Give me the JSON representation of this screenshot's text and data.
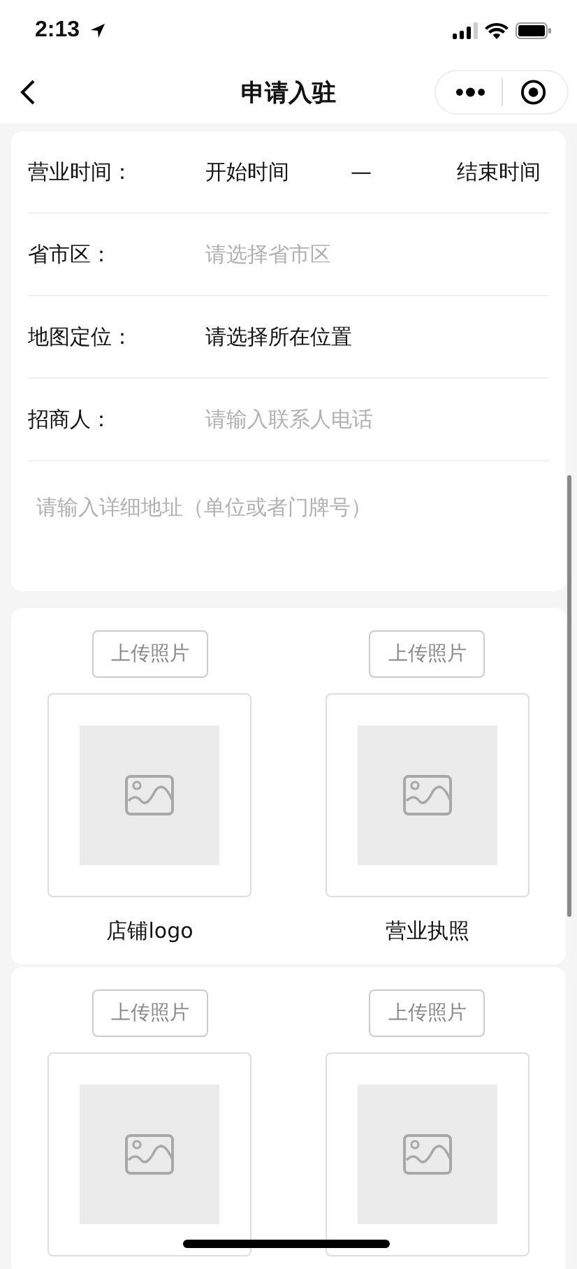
{
  "status_bar": {
    "time": "2:13"
  },
  "nav": {
    "title": "申请入驻"
  },
  "form": {
    "rows": [
      {
        "kind": "time_range",
        "label": "营业时间：",
        "start": "开始时间",
        "separator": "—",
        "end": "结束时间"
      },
      {
        "kind": "picker",
        "label": "省市区：",
        "placeholder": "请选择省市区"
      },
      {
        "kind": "picker",
        "label": "地图定位：",
        "value": "请选择所在位置"
      },
      {
        "kind": "input",
        "label": "招商人：",
        "placeholder": "请输入联系人电话"
      }
    ],
    "address": {
      "placeholder": "请输入详细地址（单位或者门牌号）"
    }
  },
  "photo_groups": [
    {
      "items": [
        {
          "button": "上传照片",
          "caption": "店铺logo"
        },
        {
          "button": "上传照片",
          "caption": "营业执照"
        }
      ]
    },
    {
      "items": [
        {
          "button": "上传照片"
        },
        {
          "button": "上传照片"
        }
      ]
    }
  ]
}
